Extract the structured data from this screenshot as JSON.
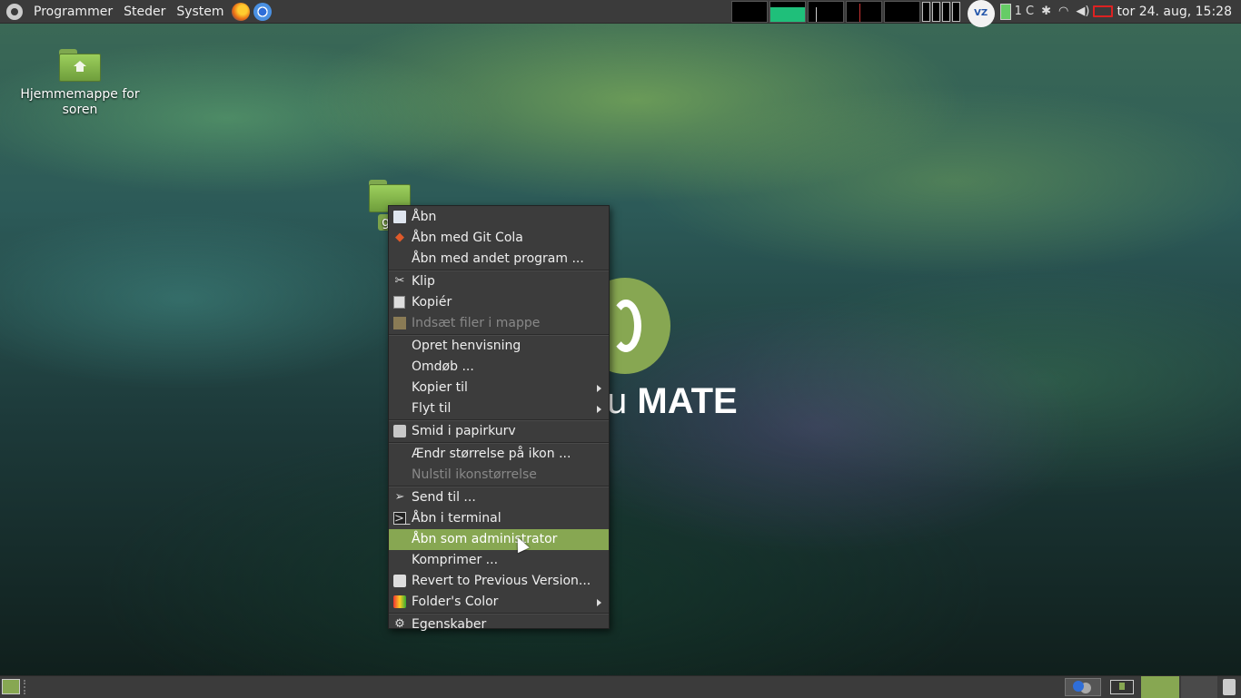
{
  "top_panel": {
    "menus": [
      "Programmer",
      "Steder",
      "System"
    ],
    "launchers": [
      "firefox-icon",
      "chromium-icon"
    ],
    "tray_cpu_text": "1 C",
    "clock": "tor 24. aug, 15:28"
  },
  "desktop": {
    "home_icon_label": "Hjemmemappe for soren",
    "folder_label": "gu",
    "logo_text_light": "u",
    "logo_text_bold": "MATE"
  },
  "context_menu": {
    "items": [
      {
        "label": "Åbn",
        "icon": "folder-open-icon"
      },
      {
        "label": "Åbn med Git Cola",
        "icon": "git-cola-icon"
      },
      {
        "label": "Åbn med andet program ..."
      },
      {
        "label": "Klip",
        "icon": "scissors-icon"
      },
      {
        "label": "Kopiér",
        "icon": "copy-icon"
      },
      {
        "label": "Indsæt filer i mappe",
        "icon": "paste-icon",
        "disabled": true
      },
      {
        "label": "Opret henvisning"
      },
      {
        "label": "Omdøb ..."
      },
      {
        "label": "Kopier til",
        "submenu": true
      },
      {
        "label": "Flyt til",
        "submenu": true
      },
      {
        "label": "Smid i papirkurv",
        "icon": "trash-icon"
      },
      {
        "label": "Ændr størrelse på ikon ..."
      },
      {
        "label": "Nulstil ikonstørrelse",
        "disabled": true
      },
      {
        "label": "Send til ...",
        "icon": "send-icon"
      },
      {
        "label": "Åbn i terminal",
        "icon": "terminal-icon"
      },
      {
        "label": "Åbn som administrator",
        "highlighted": true
      },
      {
        "label": "Komprimer ..."
      },
      {
        "label": "Revert to Previous Version...",
        "icon": "camera-icon"
      },
      {
        "label": "Folder's Color",
        "icon": "color-icon",
        "submenu": true
      },
      {
        "label": "Egenskaber",
        "icon": "gear-icon"
      }
    ]
  },
  "colors": {
    "accent": "#87a752",
    "panel": "#3b3b3b",
    "menu_bg": "#3c3c3c"
  }
}
